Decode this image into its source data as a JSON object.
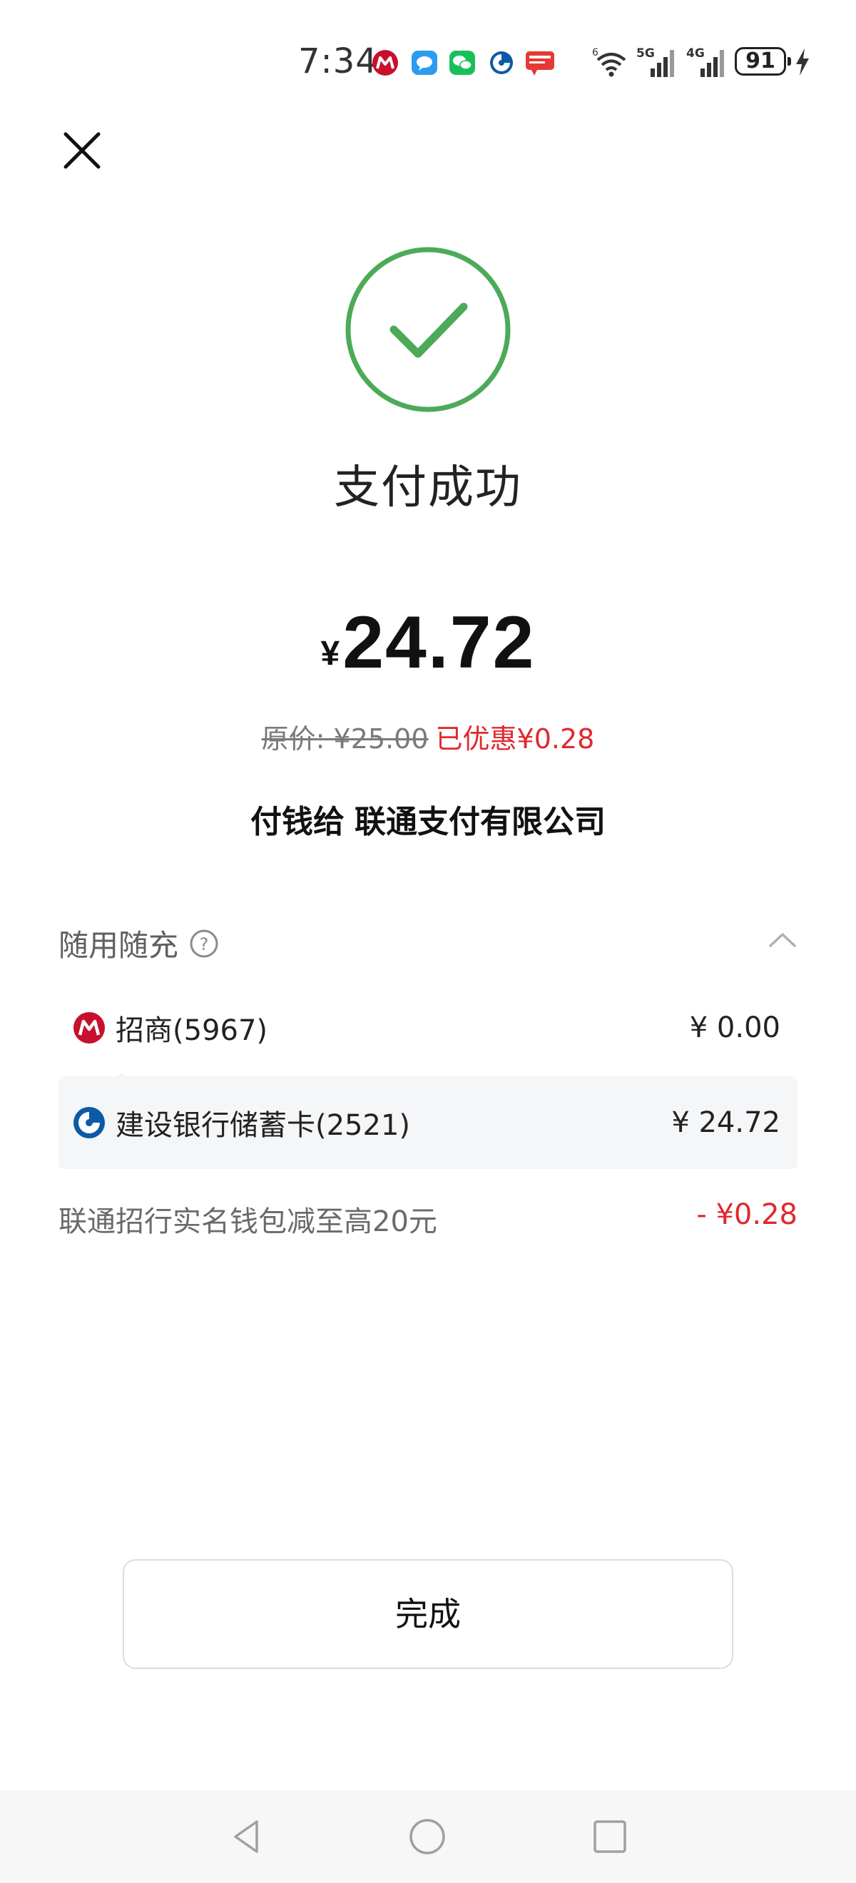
{
  "status_bar": {
    "time": "7:34",
    "notification_icons": [
      "cmb-bank-icon",
      "message-icon",
      "wechat-icon",
      "ccb-bank-icon",
      "unionpay-app-icon"
    ],
    "wifi_badge": "6",
    "network_1": "5G",
    "network_2": "4G",
    "battery_level": "91",
    "charging": true
  },
  "header": {
    "close_icon": "close-icon"
  },
  "result": {
    "icon": "success-check-icon",
    "title": "支付成功",
    "accent_color": "#4caa58"
  },
  "amount": {
    "currency": "¥",
    "value": "24.72"
  },
  "discount": {
    "original": "原价: ¥25.00",
    "saved": "已优惠¥0.28",
    "saved_color": "#e0282e"
  },
  "payee": {
    "prefix": "付钱给",
    "name": "联通支付有限公司"
  },
  "payment_section": {
    "title": "随用随充",
    "expanded": true,
    "methods": [
      {
        "icon": "cmb-bank-icon",
        "name": "招商(5967)",
        "amount": "¥ 0.00"
      },
      {
        "icon": "ccb-bank-icon",
        "name": "建设银行储蓄卡(2521)",
        "amount": "¥ 24.72"
      }
    ],
    "promotion": {
      "name": "联通招行实名钱包减至高20元",
      "amount": "- ¥0.28"
    }
  },
  "actions": {
    "done_label": "完成"
  },
  "nav_bar": {
    "icons": [
      "back-triangle-icon",
      "home-circle-icon",
      "recents-square-icon"
    ]
  }
}
